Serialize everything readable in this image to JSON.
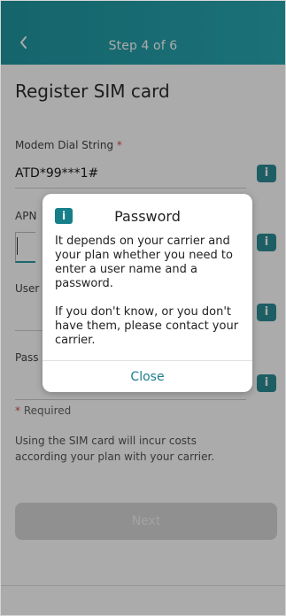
{
  "header": {
    "step_label": "Step 4 of 6"
  },
  "page": {
    "title": "Register SIM card"
  },
  "fields": {
    "modem": {
      "label": "Modem Dial String",
      "required_marker": "*",
      "value": "ATD*99***1#"
    },
    "apn": {
      "label": "APN"
    },
    "user": {
      "label": "User"
    },
    "password": {
      "label": "Pass"
    }
  },
  "info_icon_glyph": "i",
  "required_note": {
    "marker": "*",
    "text": "Required"
  },
  "cost_note": "Using the SIM card will incur costs according your plan with your carrier.",
  "next_button": {
    "label": "Next"
  },
  "dialog": {
    "icon_glyph": "i",
    "title": "Password",
    "paragraph1": "It depends on your carrier and your plan whether you need to enter a user name and a password.",
    "paragraph2": "If you don't know, or you don't have them, please contact your carrier.",
    "close_label": "Close"
  },
  "colors": {
    "header": "#2aa7b3",
    "accent": "#1b7e8a",
    "info_icon": "#2c8c96",
    "required_star": "#d0504a"
  }
}
